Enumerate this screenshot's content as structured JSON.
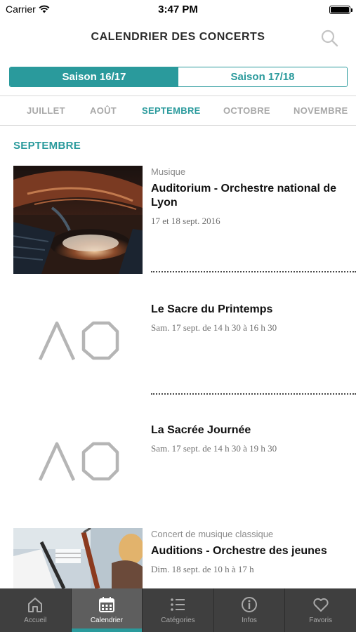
{
  "status_bar": {
    "carrier": "Carrier",
    "time": "3:47 PM"
  },
  "header": {
    "title": "CALENDRIER DES CONCERTS",
    "search_icon": "search-icon"
  },
  "seasons": [
    {
      "label": "Saison 16/17",
      "active": true
    },
    {
      "label": "Saison 17/18",
      "active": false
    }
  ],
  "months": [
    {
      "label": "JUILLET",
      "active": false
    },
    {
      "label": "AOÛT",
      "active": false
    },
    {
      "label": "SEPTEMBRE",
      "active": true
    },
    {
      "label": "OCTOBRE",
      "active": false
    },
    {
      "label": "NOVEMBRE",
      "active": false
    }
  ],
  "section": {
    "title": "SEPTEMBRE"
  },
  "events": [
    {
      "category": "Musique",
      "title": "Auditorium - Orchestre national de Lyon",
      "date": "17 et 18 sept. 2016",
      "image": "concert-hall-photo"
    },
    {
      "category": "",
      "title": "Le Sacre du Printemps",
      "date": "Sam. 17 sept. de 14 h 30 à 16 h 30",
      "image": "ao-logo-placeholder"
    },
    {
      "category": "",
      "title": "La Sacrée Journée",
      "date": "Sam. 17 sept. de 14 h 30 à 19 h 30",
      "image": "ao-logo-placeholder"
    },
    {
      "category": "Concert de musique classique",
      "title": "Auditions - Orchestre des jeunes",
      "date": "Dim. 18 sept. de 10 h à 17 h",
      "image": "bassoon-player-photo"
    }
  ],
  "tabs": [
    {
      "label": "Accueil",
      "icon": "home-icon",
      "active": false
    },
    {
      "label": "Calendrier",
      "icon": "calendar-icon",
      "active": true
    },
    {
      "label": "Catégories",
      "icon": "list-icon",
      "active": false
    },
    {
      "label": "Infos",
      "icon": "info-icon",
      "active": false
    },
    {
      "label": "Favoris",
      "icon": "heart-icon",
      "active": false
    }
  ],
  "colors": {
    "accent": "#2a9a9c",
    "tabbar": "#3f3f3f",
    "tabbar_active": "#5e5e5e"
  }
}
